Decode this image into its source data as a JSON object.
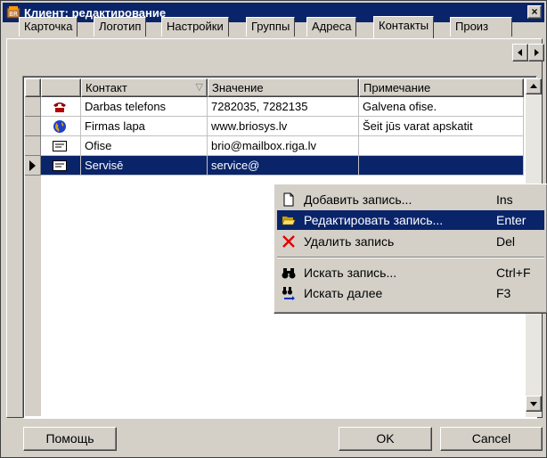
{
  "window": {
    "title": "Клиент: редактирование",
    "close_glyph": "×",
    "title_color": "#0a246a"
  },
  "tabs": [
    {
      "label": "Карточка",
      "active": false
    },
    {
      "label": "Логотип",
      "active": false
    },
    {
      "label": "Настройки",
      "active": false
    },
    {
      "label": "Группы",
      "active": false
    },
    {
      "label": "Адреса",
      "active": false
    },
    {
      "label": "Контакты",
      "active": true
    },
    {
      "label": "Произ",
      "active": false
    }
  ],
  "grid": {
    "columns": {
      "contact": "Контакт",
      "value": "Значение",
      "note": "Примечание"
    },
    "sort_glyph": "▽",
    "rows": [
      {
        "icon": "phone-icon",
        "contact": "Darbas telefons",
        "value": "7282035, 7282135",
        "note": "Galvena ofise."
      },
      {
        "icon": "globe-icon",
        "contact": "Firmas lapa",
        "value": "www.briosys.lv",
        "note": "Šeit jūs varat apskatit"
      },
      {
        "icon": "mail-icon",
        "contact": "Ofise",
        "value": "brio@mailbox.riga.lv",
        "note": ""
      },
      {
        "icon": "mail-icon",
        "contact": "Servisē",
        "value": "service@",
        "note": "",
        "selected": true
      }
    ]
  },
  "context_menu": {
    "items": [
      {
        "icon": "new-document-icon",
        "label": "Добавить запись...",
        "shortcut": "Ins",
        "highlighted": false
      },
      {
        "icon": "open-folder-icon",
        "label": "Редактировать запись...",
        "shortcut": "Enter",
        "highlighted": true
      },
      {
        "icon": "delete-x-icon",
        "label": "Удалить запись",
        "shortcut": "Del",
        "highlighted": false
      },
      {
        "icon": "binoculars-icon",
        "label": "Искать запись...",
        "shortcut": "Ctrl+F",
        "highlighted": false
      },
      {
        "icon": "binoculars-next-icon",
        "label": "Искать далее",
        "shortcut": "F3",
        "highlighted": false
      }
    ]
  },
  "buttons": {
    "help": "Помощь",
    "ok": "OK",
    "cancel": "Cancel"
  },
  "colors": {
    "selection": "#0a246a",
    "face": "#d4d0c8"
  }
}
